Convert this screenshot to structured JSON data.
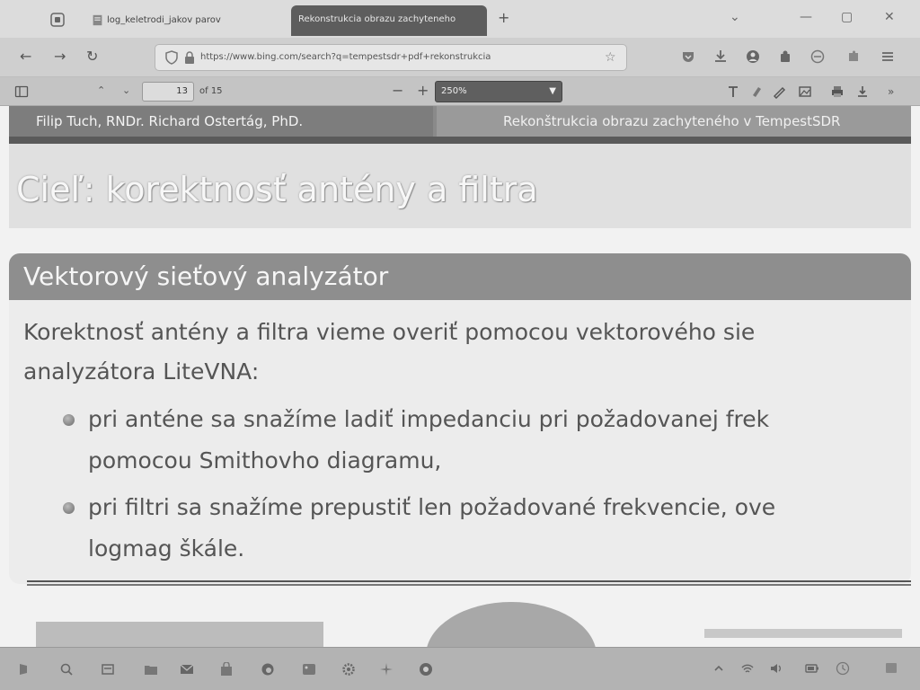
{
  "browser": {
    "tabs": [
      {
        "label": "log_keletrodi_jakov parov",
        "active": false
      },
      {
        "label": "Rekonstrukcia obrazu zachyteneho",
        "active": true
      }
    ],
    "new_tab": "+",
    "window_controls": {
      "list": "⌄",
      "minimize": "—",
      "maximize": "▢",
      "close": "✕"
    },
    "url": "https://www.bing.com/search?q=tempestsdr+pdf+rekonstrukcia",
    "star": "☆"
  },
  "pdf_toolbar": {
    "page_current": "13",
    "page_total_text": "of 15",
    "zoom_value": "250%",
    "zoom_out": "−",
    "zoom_in": "+"
  },
  "slide": {
    "header_left": "Filip Tuch, RNDr. Richard Ostertág, PhD.",
    "header_right": "Rekonštrukcia obrazu zachyteného v TempestSDR",
    "frame_title": "Cieľ: korektnosť antény a filtra",
    "block_title": "Vektorový sieťový analyzátor",
    "intro_line1": "Korektnosť antény a filtra vieme overiť pomocou vektorového sie",
    "intro_line2": "analyzátora LiteVNA:",
    "bullets": [
      {
        "line1": "pri anténe sa snažíme ladiť impedanciu pri požadovanej frek",
        "line2": "pomocou Smithovho diagramu,"
      },
      {
        "line1": "pri filtri sa snažíme prepustiť len požadované frekvencie, ove",
        "line2": "logmag škále."
      }
    ]
  },
  "colors": {
    "header_band": "#7d7d7d",
    "block_title_bg": "#8e8e8e",
    "active_tab": "#5d5d5d",
    "zoom_select": "#5f5f5f"
  },
  "icons": {
    "taskbar": [
      "search-icon",
      "task-view-icon",
      "file-explorer-icon",
      "mail-icon",
      "store-icon",
      "edge-icon",
      "photos-icon",
      "settings-icon",
      "app-icon",
      "chrome-icon"
    ],
    "tray": [
      "chevron-up-icon",
      "network-icon",
      "volume-icon",
      "battery-icon"
    ]
  }
}
